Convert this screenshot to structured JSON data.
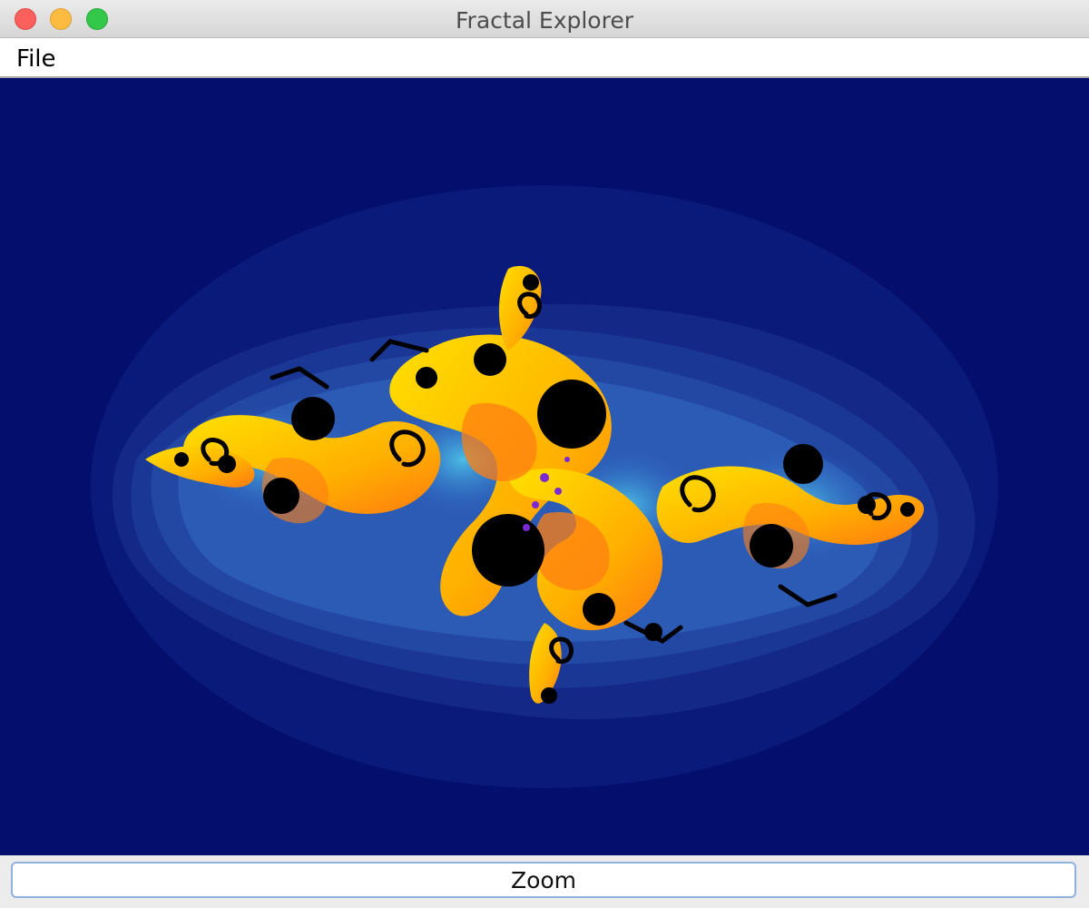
{
  "window": {
    "title": "Fractal Explorer"
  },
  "menu": {
    "items": [
      {
        "label": "File"
      }
    ]
  },
  "canvas": {
    "background_color": "#040e6c",
    "palette": [
      "#0a1a7a",
      "#162e8e",
      "#1f47a6",
      "#2f6cc4",
      "#4fc8ec",
      "#ffd400",
      "#ffa51a",
      "#ff6a10",
      "#7a2ad0",
      "#000000"
    ]
  },
  "controls": {
    "zoom_label": "Zoom"
  }
}
